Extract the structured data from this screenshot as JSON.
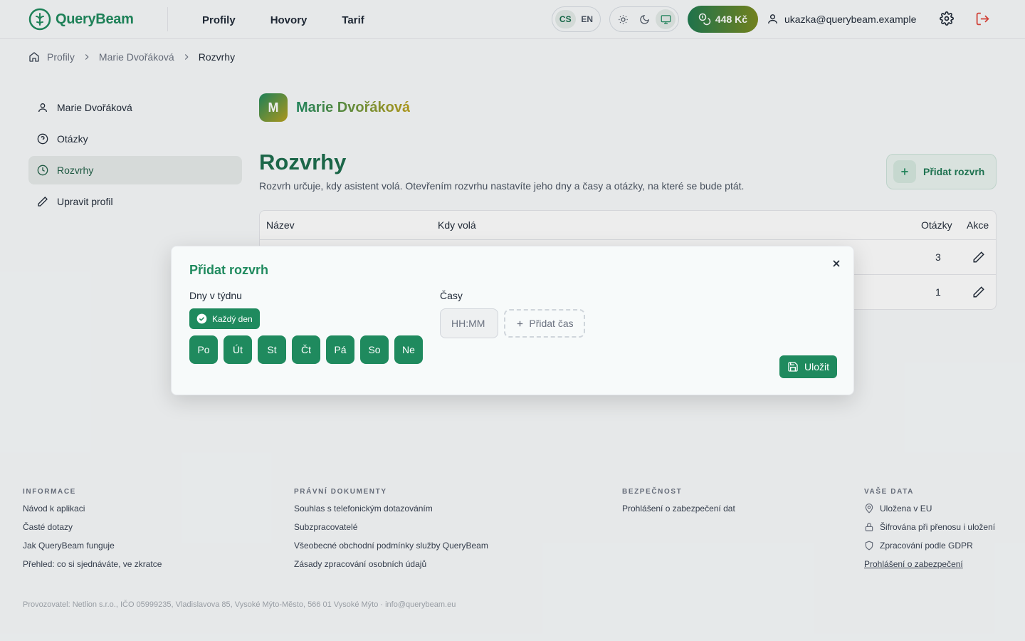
{
  "header": {
    "logo_text": "QueryBeam",
    "nav": [
      "Profily",
      "Hovory",
      "Tarif"
    ],
    "lang": [
      "CS",
      "EN"
    ],
    "credits": "448 Kč",
    "user_email": "ukazka@querybeam.example"
  },
  "breadcrumb": [
    "Profily",
    "Marie Dvořáková",
    "Rozvrhy"
  ],
  "sidebar": {
    "items": [
      {
        "label": "Marie Dvořáková"
      },
      {
        "label": "Otázky"
      },
      {
        "label": "Rozvrhy"
      },
      {
        "label": "Upravit profil"
      }
    ]
  },
  "profile": {
    "initial": "M",
    "name": "Marie Dvořáková"
  },
  "main": {
    "title": "Rozvrhy",
    "description": "Rozvrh určuje, kdy asistent volá. Otevřením rozvrhu nastavíte jeho dny a časy a otázky, na které se bude ptát.",
    "add_button": "Přidat rozvrh"
  },
  "table": {
    "headers": [
      "Název",
      "Kdy volá",
      "Otázky",
      "Akce"
    ],
    "rows": [
      {
        "questions": "3"
      },
      {
        "questions": "1"
      }
    ]
  },
  "modal": {
    "title": "Přidat rozvrh",
    "days_label": "Dny v týdnu",
    "every_day": "Každý den",
    "days": [
      "Po",
      "Út",
      "St",
      "Čt",
      "Pá",
      "So",
      "Ne"
    ],
    "times_label": "Časy",
    "time_placeholder": "HH:MM",
    "add_time": "Přidat čas",
    "save": "Uložit"
  },
  "footer": {
    "info": {
      "heading": "INFORMACE",
      "links": [
        "Návod k aplikaci",
        "Časté dotazy",
        "Jak QueryBeam funguje",
        "Přehled: co si sjednáváte, ve zkratce"
      ]
    },
    "legal": {
      "heading": "PRÁVNÍ DOKUMENTY",
      "links": [
        "Souhlas s telefonickým dotazováním",
        "Subzpracovatelé",
        "Všeobecné obchodní podmínky služby QueryBeam",
        "Zásady zpracování osobních údajů"
      ]
    },
    "security": {
      "heading": "BEZPEČNOST",
      "links": [
        "Prohlášení o zabezpečení dat"
      ]
    },
    "data": {
      "heading": "VAŠE DATA",
      "items": [
        "Uložena v EU",
        "Šifrována při přenosu i uložení",
        "Zpracování podle GDPR"
      ],
      "link": "Prohlášení o zabezpečení"
    },
    "legal_line": "Provozovatel: Netlion s.r.o., IČO 05999235, Vladislavova 85, Vysoké Mýto-Město, 566 01 Vysoké Mýto · info@querybeam.eu"
  },
  "colors": {
    "primary": "#1f8a5e",
    "accent": "#b9a11d"
  }
}
